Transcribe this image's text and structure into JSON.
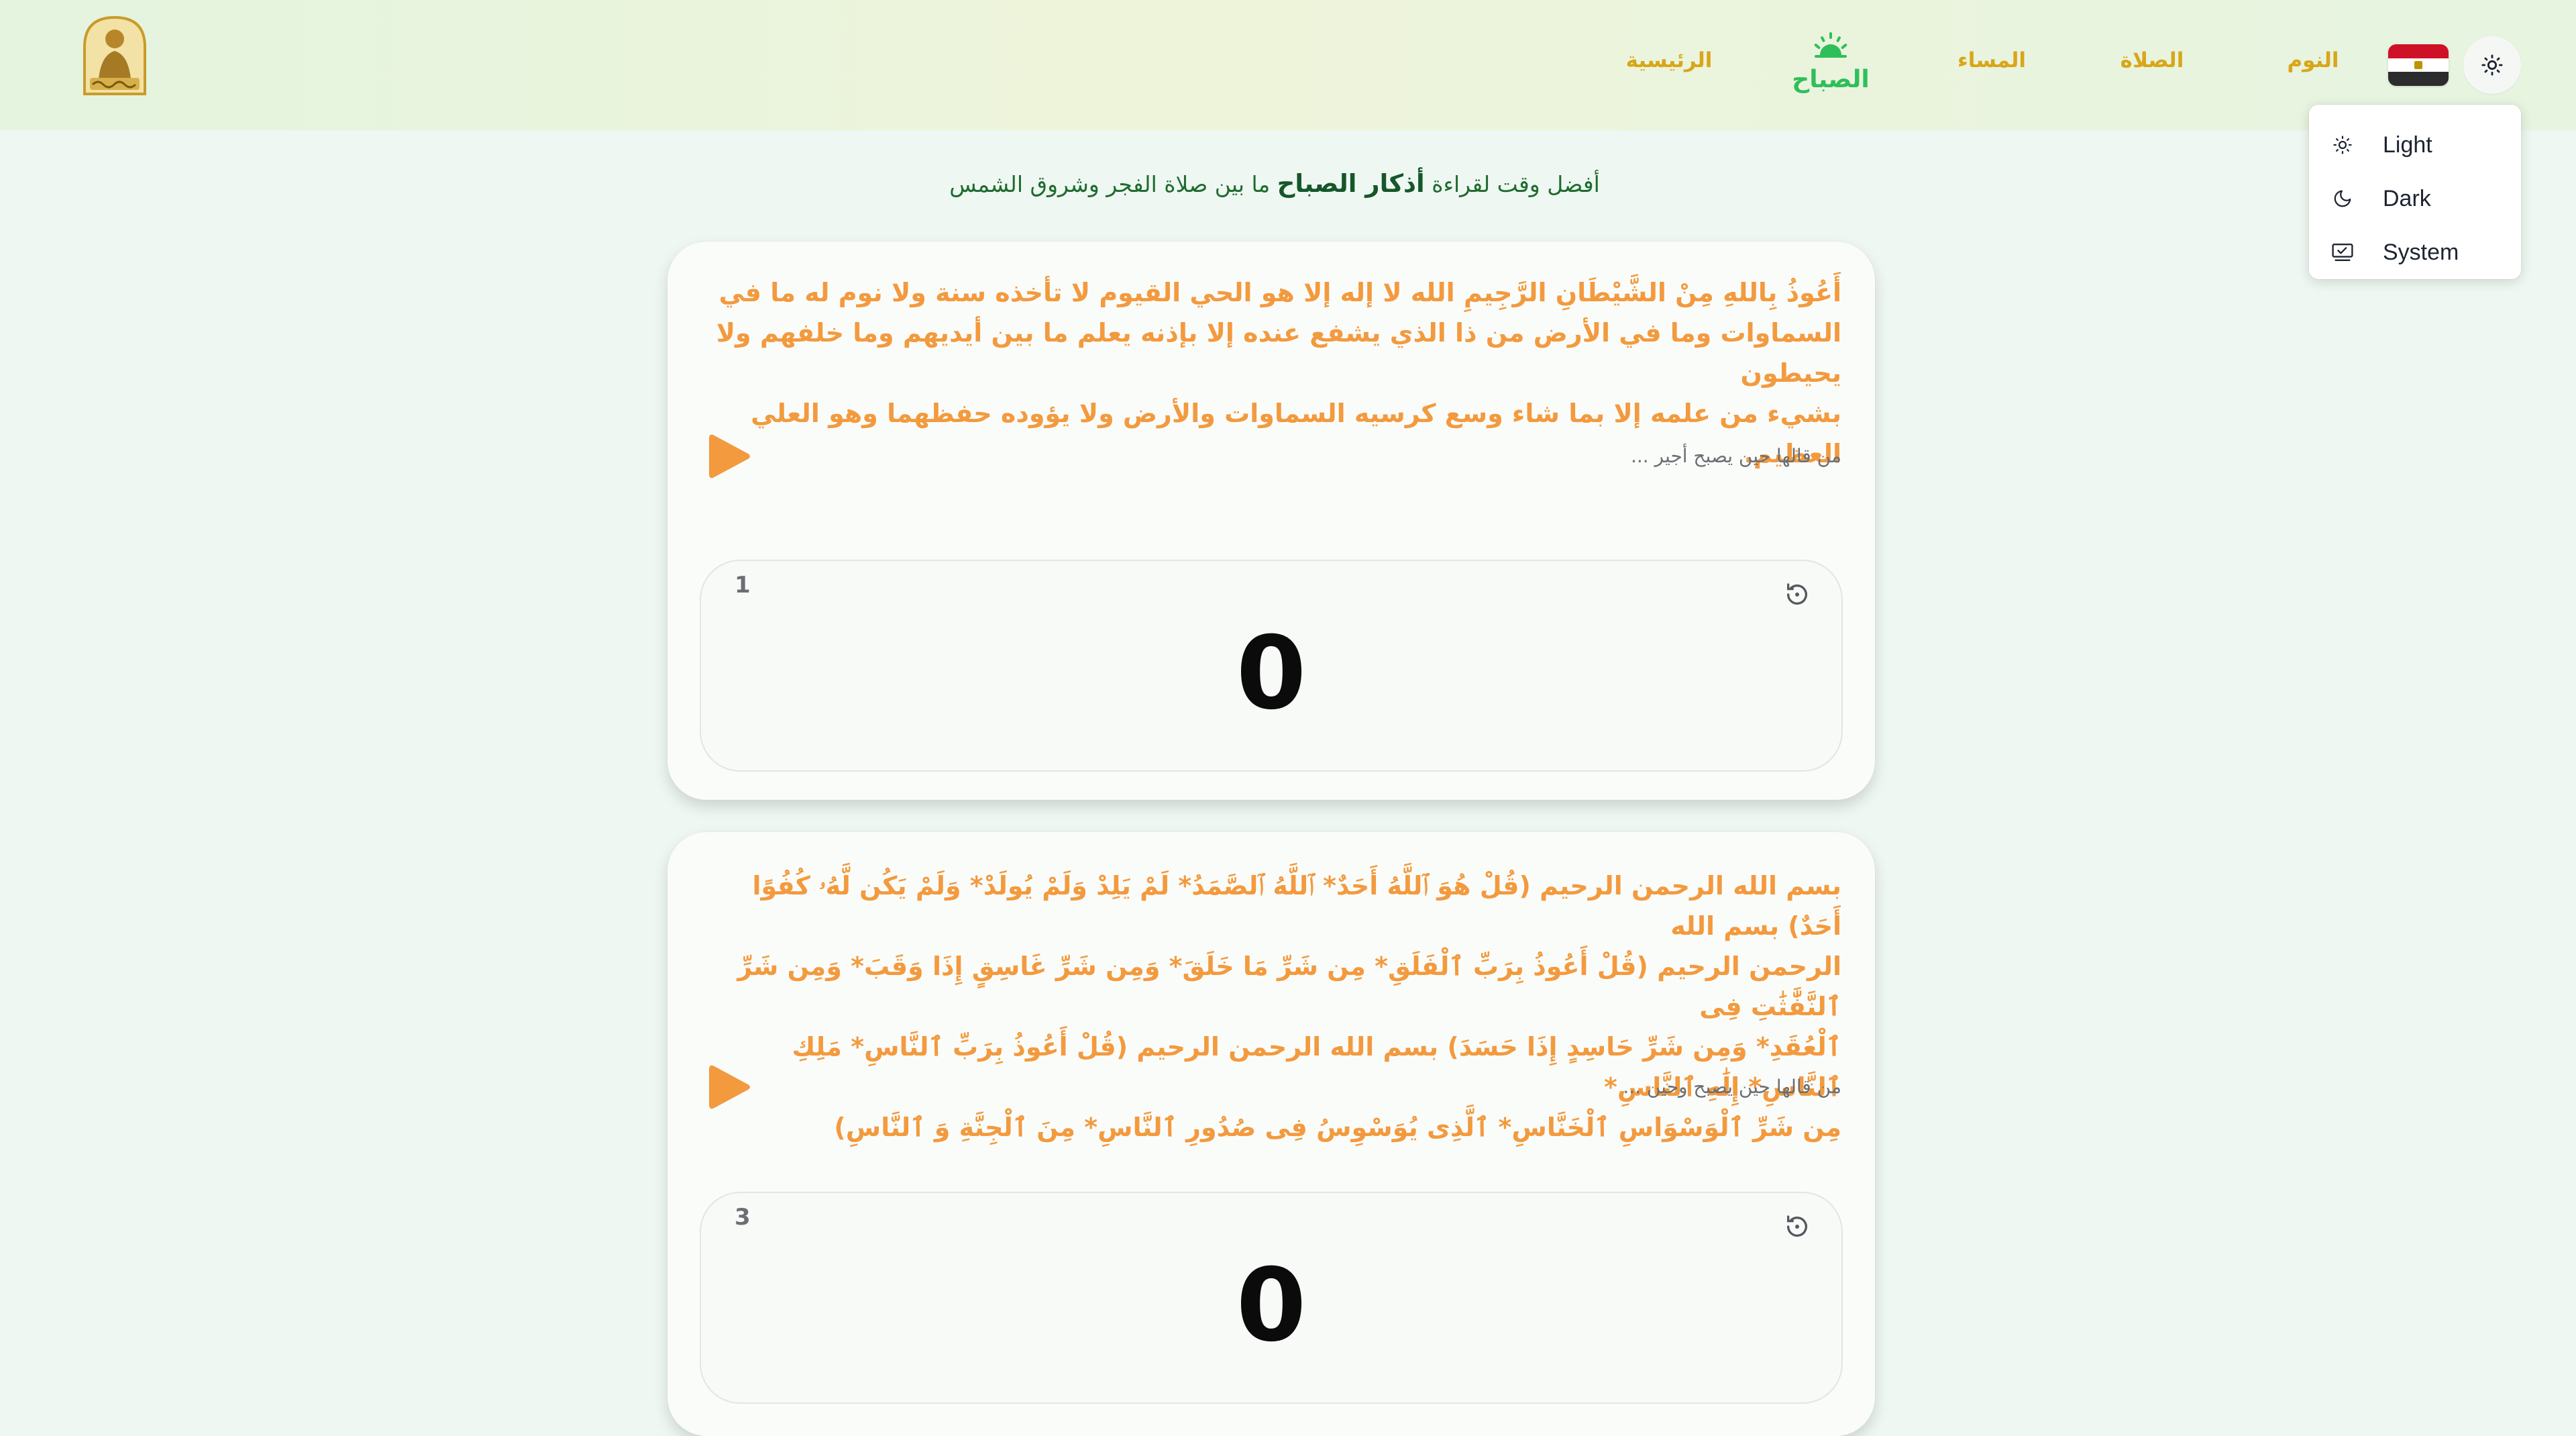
{
  "header": {
    "nav": [
      {
        "id": "home",
        "label": "الرئيسية"
      },
      {
        "id": "morning",
        "label": "الصباح",
        "active": true
      },
      {
        "id": "evening",
        "label": "المساء"
      },
      {
        "id": "prayer",
        "label": "الصلاة"
      },
      {
        "id": "sleep",
        "label": "النوم"
      }
    ],
    "flag": {
      "country": "Egypt",
      "colors": [
        "#ce1126",
        "#ffffff",
        "#000000"
      ]
    },
    "theme_icon": "sun-icon"
  },
  "theme_menu": {
    "items": [
      {
        "id": "light",
        "label": "Light",
        "icon": "sun-icon"
      },
      {
        "id": "dark",
        "label": "Dark",
        "icon": "moon-icon"
      },
      {
        "id": "system",
        "label": "System",
        "icon": "monitor-icon"
      }
    ]
  },
  "subtitle": {
    "before": "أفضل وقت لقراءة ",
    "highlight": "أذكار الصباح",
    "after": " ما بين صلاة الفجر وشروق الشمس"
  },
  "cards": [
    {
      "text": "أَعُوذُ بِاللهِ مِنْ الشَّيْطَانِ الرَّجِيمِ الله لا إله إلا هو الحي القيوم لا تأخذه سنة ولا نوم له ما في\nالسماوات وما في الأرض من ذا الذي يشفع عنده إلا بإذنه يعلم ما بين أيديهم وما خلفهم ولا يحيطون\nبشيء من علمه إلا بما شاء وسع كرسيه السماوات والأرض ولا يؤوده حفظهما وهو العلي العظيم.",
      "note": "من قالها حين يصبح أجير ...",
      "target": "1",
      "count": "0"
    },
    {
      "text": "بسم الله الرحمن الرحيم (قُلْ هُوَ ٱللَّهُ أَحَدٌ* ٱللَّهُ ٱلصَّمَدُ* لَمْ يَلِدْ وَلَمْ يُولَدْ* وَلَمْ يَكُن لَّهُۥ كُفُوًا أَحَدٌ) بسم الله\nالرحمن الرحيم (قُلْ أَعُوذُ بِرَبِّ ٱلْفَلَقِ* مِن شَرِّ مَا خَلَقَ* وَمِن شَرِّ غَاسِقٍ إِذَا وَقَبَ* وَمِن شَرِّ ٱلنَّفَّٰثَٰتِ فِى\nٱلْعُقَدِ* وَمِن شَرِّ حَاسِدٍ إِذَا حَسَدَ) بسم الله الرحمن الرحيم (قُلْ أَعُوذُ بِرَبِّ ٱلنَّاسِ* مَلِكِ ٱلنَّاسِ* إِلَٰهِ ٱلنَّاسِ*\nمِن شَرِّ ٱلْوَسْوَاسِ ٱلْخَنَّاسِ* ٱلَّذِى يُوَسْوِسُ فِى صُدُورِ ٱلنَّاسِ* مِنَ ٱلْجِنَّةِ وَ ٱلنَّاسِ)",
      "note": "من قالها حين يصبح وحين ...",
      "target": "3",
      "count": "0"
    }
  ],
  "colors": {
    "accent_orange": "#f39a3e",
    "nav_gold": "#d9a619",
    "nav_active_green": "#2fbf5a",
    "subtitle_green": "#1f6b2f"
  }
}
